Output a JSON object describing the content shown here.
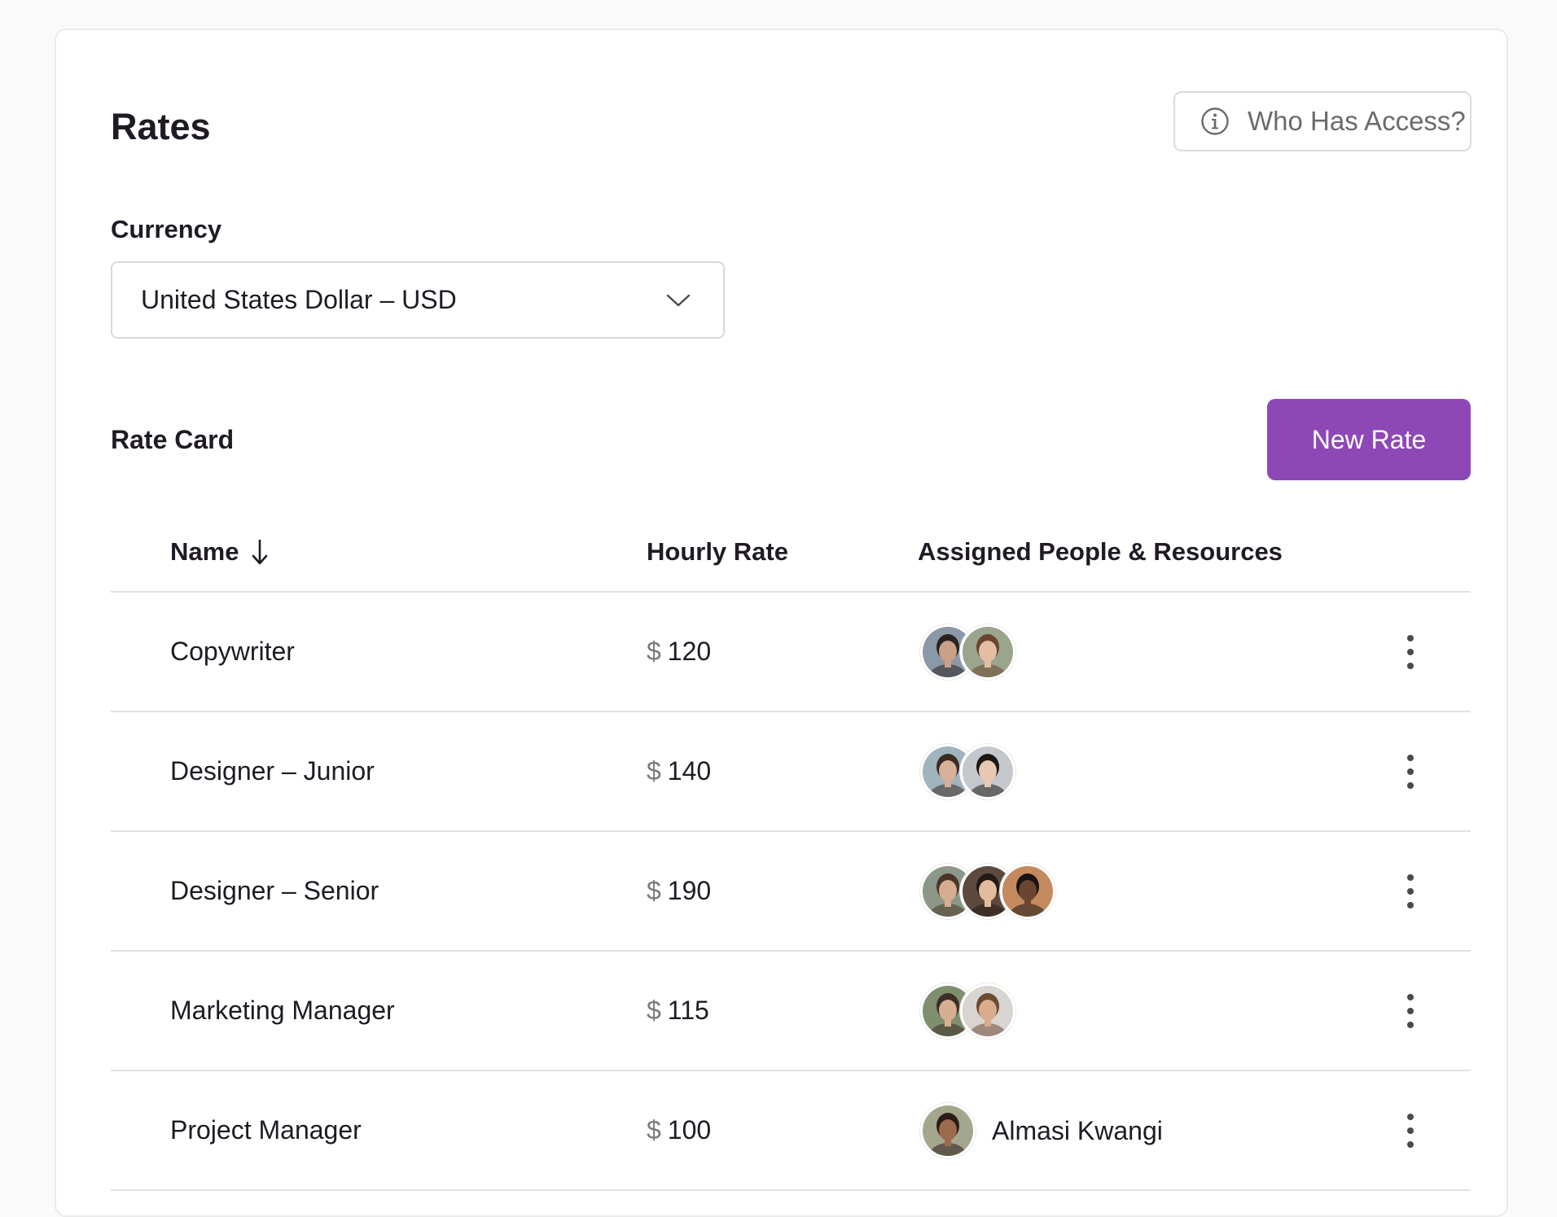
{
  "page": {
    "title": "Rates",
    "access_button_label": "Who Has Access?",
    "access_icon": "info-icon"
  },
  "currency": {
    "label": "Currency",
    "selected": "United States Dollar – USD"
  },
  "rate_card": {
    "label": "Rate Card",
    "new_rate_label": "New Rate",
    "accent_color": "#8e48b6"
  },
  "table": {
    "columns": {
      "name": "Name",
      "hourly_rate": "Hourly Rate",
      "assigned": "Assigned People & Resources"
    },
    "sort_icon": "arrow-down-icon",
    "currency_symbol": "$",
    "rows": [
      {
        "name": "Copywriter",
        "rate": "120",
        "avatars": [
          {
            "bg": "#8a98a8",
            "skin": "#c9a088",
            "hair": "#2a2220"
          },
          {
            "bg": "#9aa58c",
            "skin": "#e3bea4",
            "hair": "#6a4632"
          }
        ],
        "assignee_name": ""
      },
      {
        "name": "Designer – Junior",
        "rate": "140",
        "avatars": [
          {
            "bg": "#9fb4bd",
            "skin": "#d8b09a",
            "hair": "#3a2c24"
          },
          {
            "bg": "#c4c8cc",
            "skin": "#e8c8b2",
            "hair": "#1c1714"
          }
        ],
        "assignee_name": ""
      },
      {
        "name": "Designer – Senior",
        "rate": "190",
        "avatars": [
          {
            "bg": "#8d9787",
            "skin": "#d5ad92",
            "hair": "#4a3628"
          },
          {
            "bg": "#5d4a3e",
            "skin": "#e2bc9c",
            "hair": "#221a16"
          },
          {
            "bg": "#c48a5e",
            "skin": "#6a4532",
            "hair": "#1a1412"
          }
        ],
        "assignee_name": ""
      },
      {
        "name": "Marketing Manager",
        "rate": "115",
        "avatars": [
          {
            "bg": "#7f8f6e",
            "skin": "#d6ae90",
            "hair": "#3c2e24"
          },
          {
            "bg": "#d8d4d0",
            "skin": "#d9ac8e",
            "hair": "#6b4a34"
          }
        ],
        "assignee_name": ""
      },
      {
        "name": "Project Manager",
        "rate": "100",
        "avatars": [
          {
            "bg": "#a5a68e",
            "skin": "#9c6a4c",
            "hair": "#2a1c16"
          }
        ],
        "assignee_name": "Almasi Kwangi"
      }
    ]
  }
}
